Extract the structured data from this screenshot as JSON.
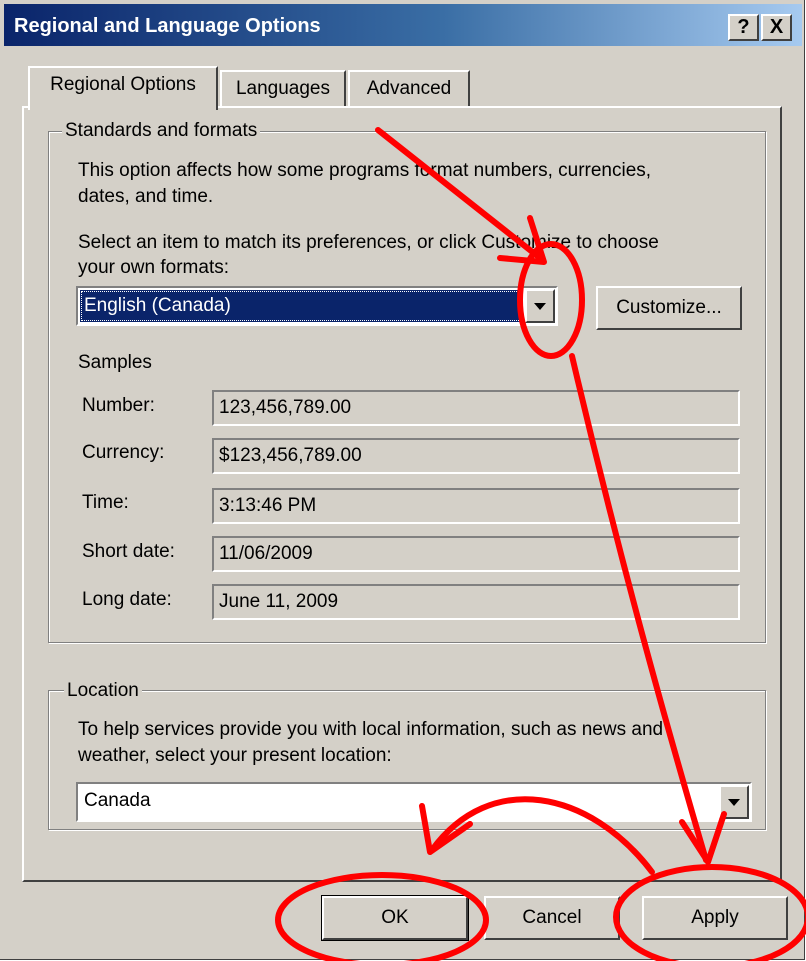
{
  "window": {
    "title": "Regional and Language Options",
    "help_glyph": "?",
    "close_glyph": "X"
  },
  "tabs": [
    {
      "label": "Regional Options",
      "active": true
    },
    {
      "label": "Languages",
      "active": false
    },
    {
      "label": "Advanced",
      "active": false
    }
  ],
  "standards": {
    "legend": "Standards and formats",
    "description_line1": "This option affects how some programs format numbers, currencies,",
    "description_line2": "dates, and time.",
    "instruction_line1": "Select an item to match its preferences, or click Customize to choose",
    "instruction_line2": "your own formats:",
    "selected_format": "English (Canada)",
    "customize_label": "Customize...",
    "samples_heading": "Samples",
    "samples": [
      {
        "label": "Number:",
        "value": "123,456,789.00"
      },
      {
        "label": "Currency:",
        "value": "$123,456,789.00"
      },
      {
        "label": "Time:",
        "value": "3:13:46 PM"
      },
      {
        "label": "Short date:",
        "value": "11/06/2009"
      },
      {
        "label": "Long date:",
        "value": "June 11, 2009"
      }
    ]
  },
  "location": {
    "legend": "Location",
    "description_line1": "To help services provide you with local information, such as news and",
    "description_line2": "weather, select your present location:",
    "selected": "Canada"
  },
  "buttons": {
    "ok": "OK",
    "cancel": "Cancel",
    "apply": "Apply"
  },
  "colors": {
    "face": "#d4d0c8",
    "title_start": "#0a246a",
    "selection": "#0a246a",
    "annotation": "#ff0000"
  }
}
